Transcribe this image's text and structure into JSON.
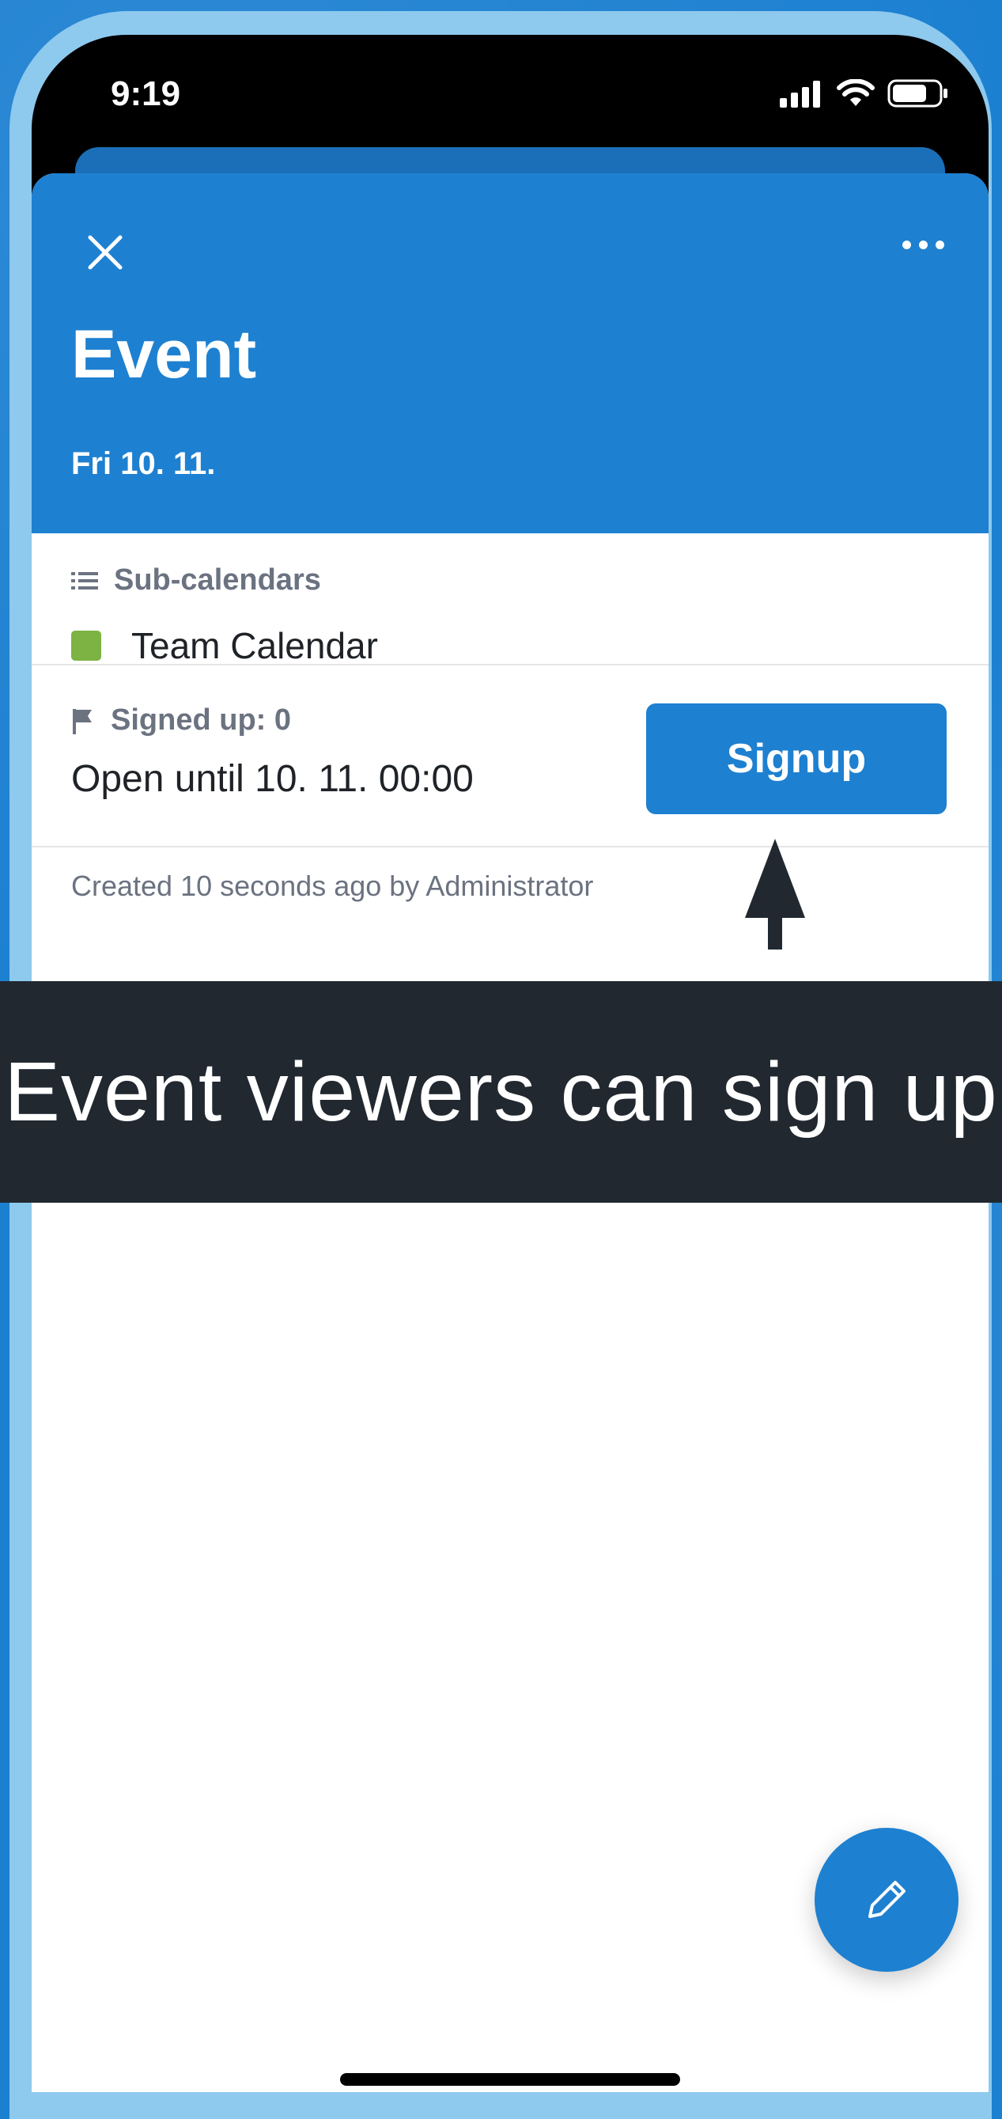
{
  "status_bar": {
    "time": "9:19"
  },
  "event": {
    "title": "Event",
    "date": "Fri 10. 11."
  },
  "sub_calendars": {
    "label": "Sub-calendars",
    "items": [
      {
        "name": "Team Calendar",
        "color": "#7cb342"
      }
    ]
  },
  "signup": {
    "signed_up_label": "Signed up: 0",
    "open_until": "Open until 10. 11. 00:00",
    "button_label": "Signup"
  },
  "created_text": "Created 10 seconds ago by Administrator",
  "callout": {
    "text": "Event viewers can sign up"
  },
  "colors": {
    "accent": "#1e80d0",
    "banner_bg": "#212830",
    "calendar_swatch": "#7cb342"
  },
  "icons": [
    "close-icon",
    "more-icon",
    "list-icon",
    "flag-icon",
    "pencil-icon",
    "signal-icon",
    "wifi-icon",
    "battery-icon"
  ]
}
